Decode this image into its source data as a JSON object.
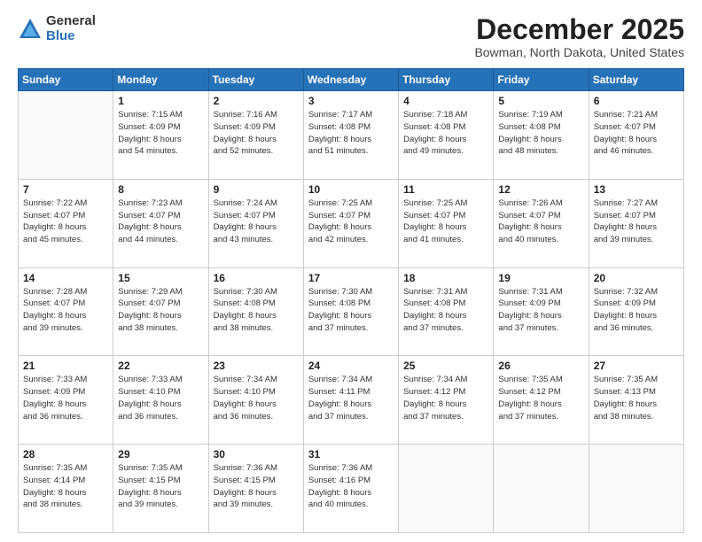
{
  "logo": {
    "general": "General",
    "blue": "Blue"
  },
  "header": {
    "month": "December 2025",
    "location": "Bowman, North Dakota, United States"
  },
  "weekdays": [
    "Sunday",
    "Monday",
    "Tuesday",
    "Wednesday",
    "Thursday",
    "Friday",
    "Saturday"
  ],
  "weeks": [
    [
      {
        "day": "",
        "info": ""
      },
      {
        "day": "1",
        "info": "Sunrise: 7:15 AM\nSunset: 4:09 PM\nDaylight: 8 hours\nand 54 minutes."
      },
      {
        "day": "2",
        "info": "Sunrise: 7:16 AM\nSunset: 4:09 PM\nDaylight: 8 hours\nand 52 minutes."
      },
      {
        "day": "3",
        "info": "Sunrise: 7:17 AM\nSunset: 4:08 PM\nDaylight: 8 hours\nand 51 minutes."
      },
      {
        "day": "4",
        "info": "Sunrise: 7:18 AM\nSunset: 4:08 PM\nDaylight: 8 hours\nand 49 minutes."
      },
      {
        "day": "5",
        "info": "Sunrise: 7:19 AM\nSunset: 4:08 PM\nDaylight: 8 hours\nand 48 minutes."
      },
      {
        "day": "6",
        "info": "Sunrise: 7:21 AM\nSunset: 4:07 PM\nDaylight: 8 hours\nand 46 minutes."
      }
    ],
    [
      {
        "day": "7",
        "info": "Sunrise: 7:22 AM\nSunset: 4:07 PM\nDaylight: 8 hours\nand 45 minutes."
      },
      {
        "day": "8",
        "info": "Sunrise: 7:23 AM\nSunset: 4:07 PM\nDaylight: 8 hours\nand 44 minutes."
      },
      {
        "day": "9",
        "info": "Sunrise: 7:24 AM\nSunset: 4:07 PM\nDaylight: 8 hours\nand 43 minutes."
      },
      {
        "day": "10",
        "info": "Sunrise: 7:25 AM\nSunset: 4:07 PM\nDaylight: 8 hours\nand 42 minutes."
      },
      {
        "day": "11",
        "info": "Sunrise: 7:25 AM\nSunset: 4:07 PM\nDaylight: 8 hours\nand 41 minutes."
      },
      {
        "day": "12",
        "info": "Sunrise: 7:26 AM\nSunset: 4:07 PM\nDaylight: 8 hours\nand 40 minutes."
      },
      {
        "day": "13",
        "info": "Sunrise: 7:27 AM\nSunset: 4:07 PM\nDaylight: 8 hours\nand 39 minutes."
      }
    ],
    [
      {
        "day": "14",
        "info": "Sunrise: 7:28 AM\nSunset: 4:07 PM\nDaylight: 8 hours\nand 39 minutes."
      },
      {
        "day": "15",
        "info": "Sunrise: 7:29 AM\nSunset: 4:07 PM\nDaylight: 8 hours\nand 38 minutes."
      },
      {
        "day": "16",
        "info": "Sunrise: 7:30 AM\nSunset: 4:08 PM\nDaylight: 8 hours\nand 38 minutes."
      },
      {
        "day": "17",
        "info": "Sunrise: 7:30 AM\nSunset: 4:08 PM\nDaylight: 8 hours\nand 37 minutes."
      },
      {
        "day": "18",
        "info": "Sunrise: 7:31 AM\nSunset: 4:08 PM\nDaylight: 8 hours\nand 37 minutes."
      },
      {
        "day": "19",
        "info": "Sunrise: 7:31 AM\nSunset: 4:09 PM\nDaylight: 8 hours\nand 37 minutes."
      },
      {
        "day": "20",
        "info": "Sunrise: 7:32 AM\nSunset: 4:09 PM\nDaylight: 8 hours\nand 36 minutes."
      }
    ],
    [
      {
        "day": "21",
        "info": "Sunrise: 7:33 AM\nSunset: 4:09 PM\nDaylight: 8 hours\nand 36 minutes."
      },
      {
        "day": "22",
        "info": "Sunrise: 7:33 AM\nSunset: 4:10 PM\nDaylight: 8 hours\nand 36 minutes."
      },
      {
        "day": "23",
        "info": "Sunrise: 7:34 AM\nSunset: 4:10 PM\nDaylight: 8 hours\nand 36 minutes."
      },
      {
        "day": "24",
        "info": "Sunrise: 7:34 AM\nSunset: 4:11 PM\nDaylight: 8 hours\nand 37 minutes."
      },
      {
        "day": "25",
        "info": "Sunrise: 7:34 AM\nSunset: 4:12 PM\nDaylight: 8 hours\nand 37 minutes."
      },
      {
        "day": "26",
        "info": "Sunrise: 7:35 AM\nSunset: 4:12 PM\nDaylight: 8 hours\nand 37 minutes."
      },
      {
        "day": "27",
        "info": "Sunrise: 7:35 AM\nSunset: 4:13 PM\nDaylight: 8 hours\nand 38 minutes."
      }
    ],
    [
      {
        "day": "28",
        "info": "Sunrise: 7:35 AM\nSunset: 4:14 PM\nDaylight: 8 hours\nand 38 minutes."
      },
      {
        "day": "29",
        "info": "Sunrise: 7:35 AM\nSunset: 4:15 PM\nDaylight: 8 hours\nand 39 minutes."
      },
      {
        "day": "30",
        "info": "Sunrise: 7:36 AM\nSunset: 4:15 PM\nDaylight: 8 hours\nand 39 minutes."
      },
      {
        "day": "31",
        "info": "Sunrise: 7:36 AM\nSunset: 4:16 PM\nDaylight: 8 hours\nand 40 minutes."
      },
      {
        "day": "",
        "info": ""
      },
      {
        "day": "",
        "info": ""
      },
      {
        "day": "",
        "info": ""
      }
    ]
  ]
}
